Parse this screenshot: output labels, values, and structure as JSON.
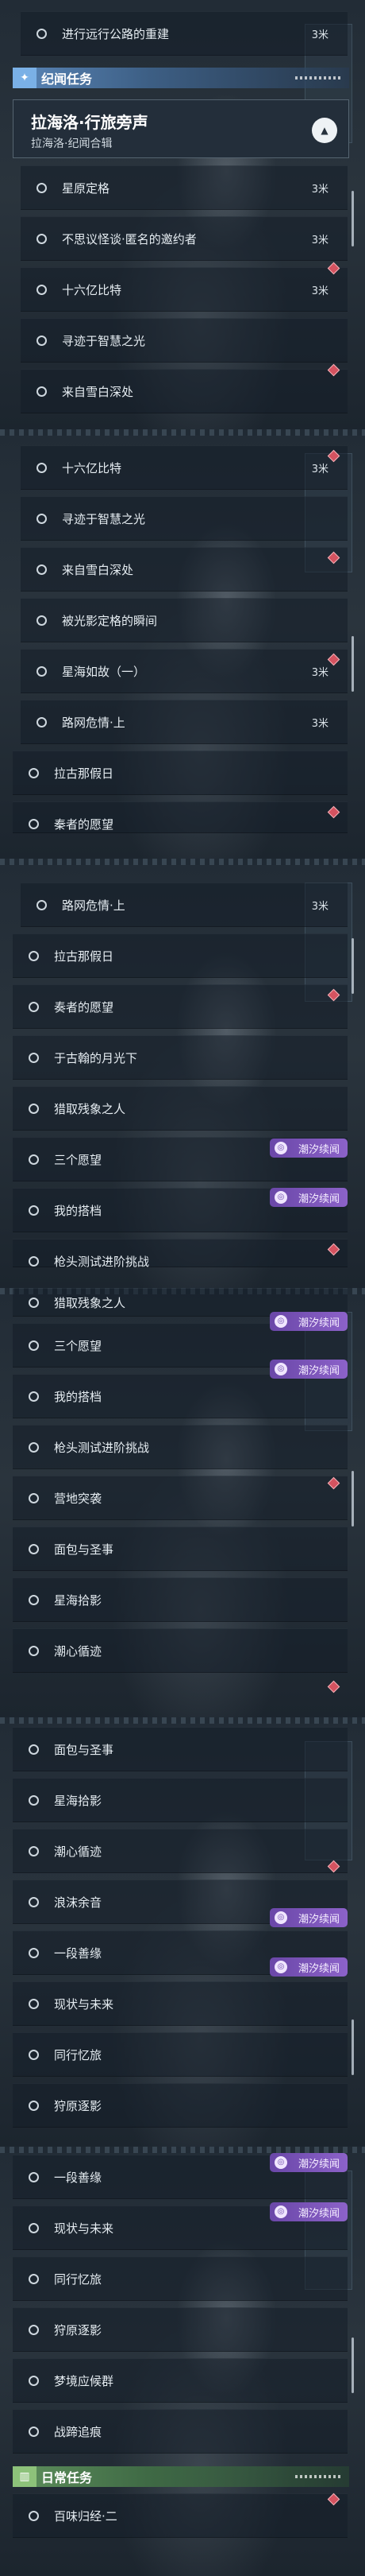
{
  "strips": [
    {
      "top_task": {
        "label": "进行远行公路的重建",
        "distance": "3米"
      },
      "section": {
        "title": "纪闻任务"
      },
      "chain": {
        "title": "拉海洛·行旅旁声",
        "subtitle": "拉海洛·纪闻合辑"
      },
      "items": [
        {
          "label": "星原定格",
          "distance": "3米"
        },
        {
          "label": "不思议怪谈·匿名的邀约者",
          "distance": "3米"
        },
        {
          "label": "十六亿比特",
          "distance": "3米"
        },
        {
          "label": "寻迹于智慧之光",
          "distance": ""
        },
        {
          "label": "来自雪白深处",
          "distance": ""
        }
      ]
    },
    {
      "items": [
        {
          "label": "十六亿比特",
          "distance": "3米"
        },
        {
          "label": "寻迹于智慧之光",
          "distance": ""
        },
        {
          "label": "来自雪白深处",
          "distance": ""
        },
        {
          "label": "被光影定格的瞬间",
          "distance": ""
        },
        {
          "label": "星海如故（一）",
          "distance": "3米"
        },
        {
          "label": "路网危情·上",
          "distance": "3米"
        },
        {
          "label": "拉古那假日",
          "distance": ""
        },
        {
          "label": "秦者的愿望",
          "distance": ""
        }
      ]
    },
    {
      "items": [
        {
          "label": "路网危情·上",
          "distance": "3米"
        },
        {
          "label": "拉古那假日",
          "distance": ""
        },
        {
          "label": "奏者的愿望",
          "distance": ""
        },
        {
          "label": "于古翰的月光下",
          "distance": ""
        },
        {
          "label": "猎取残象之人",
          "distance": ""
        },
        {
          "label": "三个愿望",
          "distance": ""
        },
        {
          "label": "我的搭档",
          "distance": ""
        },
        {
          "label": "枪头测试进阶挑战",
          "distance": ""
        }
      ]
    },
    {
      "items": [
        {
          "label": "猎取残象之人",
          "distance": ""
        },
        {
          "label": "三个愿望",
          "distance": ""
        },
        {
          "label": "我的搭档",
          "distance": ""
        },
        {
          "label": "枪头测试进阶挑战",
          "distance": ""
        },
        {
          "label": "营地突袭",
          "distance": ""
        },
        {
          "label": "面包与圣事",
          "distance": ""
        },
        {
          "label": "星海拾影",
          "distance": ""
        },
        {
          "label": "潮心循迹",
          "distance": ""
        }
      ]
    },
    {
      "items": [
        {
          "label": "面包与圣事",
          "distance": ""
        },
        {
          "label": "星海拾影",
          "distance": ""
        },
        {
          "label": "潮心循迹",
          "distance": ""
        },
        {
          "label": "浪沫余音",
          "distance": ""
        },
        {
          "label": "一段善缘",
          "distance": ""
        },
        {
          "label": "现状与未来",
          "distance": ""
        },
        {
          "label": "同行忆旅",
          "distance": ""
        },
        {
          "label": "狩原逐影",
          "distance": ""
        }
      ]
    },
    {
      "items": [
        {
          "label": "一段善缘",
          "distance": ""
        },
        {
          "label": "现状与未来",
          "distance": ""
        },
        {
          "label": "同行忆旅",
          "distance": ""
        },
        {
          "label": "狩原逐影",
          "distance": ""
        },
        {
          "label": "梦境应候群",
          "distance": ""
        },
        {
          "label": "战蹄追痕",
          "distance": ""
        }
      ],
      "section": {
        "title": "日常任务"
      },
      "daily_items": [
        {
          "label": "百味归经·二",
          "distance": ""
        }
      ]
    }
  ],
  "badge_label": "潮汐续闻",
  "icons": {
    "section_lore": "sparkle-icon",
    "section_daily": "book-icon",
    "collapse": "chevron-up-icon",
    "tracked": "diamond-marker-icon",
    "badge": "tide-icon",
    "task": "radio-circle-icon"
  },
  "colors": {
    "badge": "#7a52b8",
    "marker": "#d45360",
    "lore_header": "#5a86b8",
    "daily_header": "#5e8f5c"
  }
}
